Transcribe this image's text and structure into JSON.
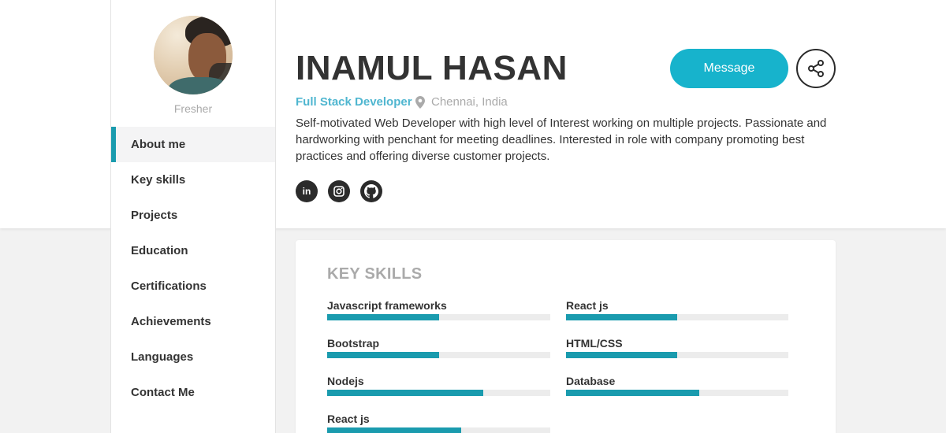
{
  "profile": {
    "status": "Fresher",
    "name": "INAMUL HASAN",
    "role": "Full Stack Developer",
    "location": "Chennai, India",
    "bio": "Self-motivated Web Developer with high level of Interest working on multiple projects. Passionate and hardworking with penchant for meeting deadlines. Interested in role with company promoting best practices and offering diverse customer projects."
  },
  "nav": {
    "items": [
      {
        "label": "About me",
        "active": true
      },
      {
        "label": "Key skills",
        "active": false
      },
      {
        "label": "Projects",
        "active": false
      },
      {
        "label": "Education",
        "active": false
      },
      {
        "label": "Certifications",
        "active": false
      },
      {
        "label": "Achievements",
        "active": false
      },
      {
        "label": "Languages",
        "active": false
      },
      {
        "label": "Contact Me",
        "active": false
      }
    ]
  },
  "actions": {
    "message_label": "Message",
    "share_icon": "share-icon"
  },
  "socials": [
    {
      "icon": "linkedin-icon",
      "glyph": "in"
    },
    {
      "icon": "instagram-icon"
    },
    {
      "icon": "github-icon"
    }
  ],
  "skills_section": {
    "title": "KEY SKILLS",
    "skills": [
      {
        "name": "Javascript frameworks",
        "level": 0.5
      },
      {
        "name": "React js",
        "level": 0.5
      },
      {
        "name": "Bootstrap",
        "level": 0.5
      },
      {
        "name": "HTML/CSS",
        "level": 0.5
      },
      {
        "name": "Nodejs",
        "level": 0.7
      },
      {
        "name": "Database",
        "level": 0.6
      },
      {
        "name": "React js",
        "level": 0.6
      }
    ]
  },
  "colors": {
    "accent": "#17b3cc",
    "bar_fill": "#1a9bae",
    "role_text": "#4fb6d0",
    "muted_text": "#aaaaaa"
  }
}
